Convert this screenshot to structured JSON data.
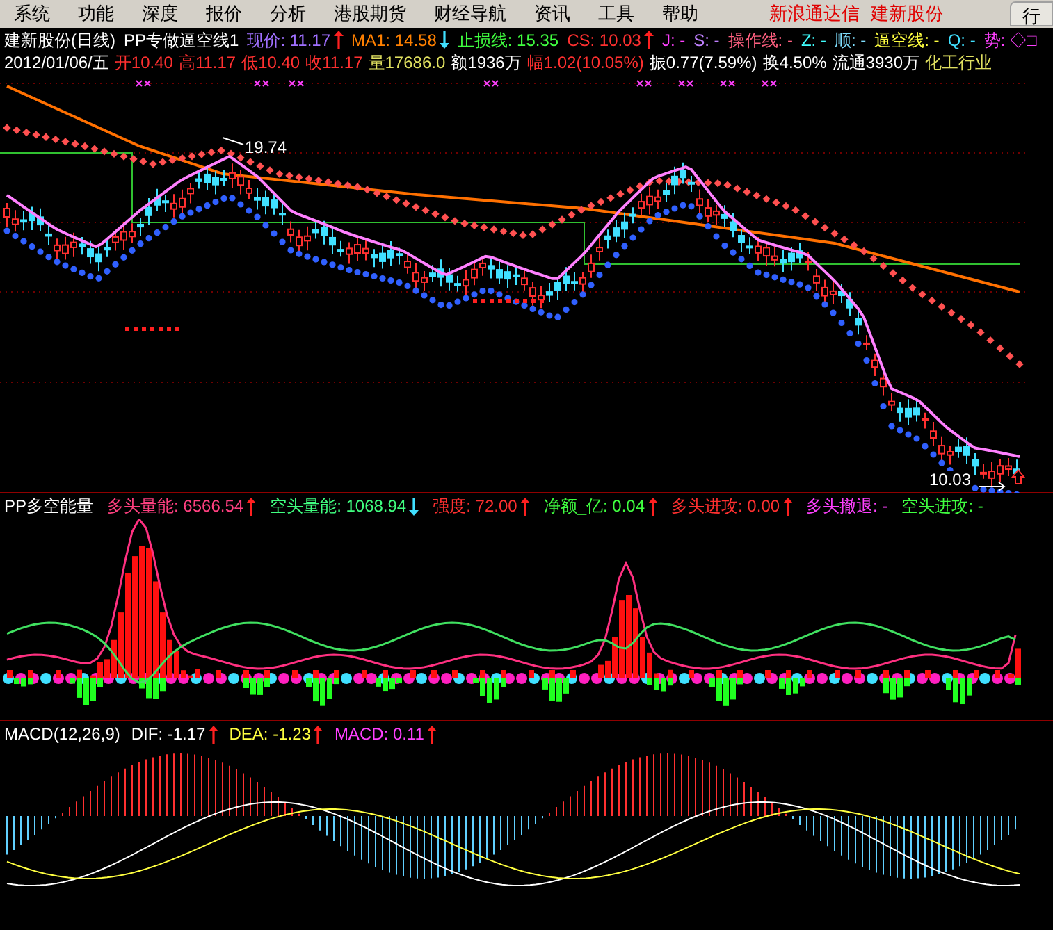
{
  "menu": {
    "items": [
      "系统",
      "功能",
      "深度",
      "报价",
      "分析",
      "港股期货",
      "财经导航",
      "资讯",
      "工具",
      "帮助"
    ],
    "titles": [
      "新浪通达信",
      "建新股份"
    ],
    "tab_button": "行"
  },
  "price_panel": {
    "header": [
      {
        "text": "建新股份(日线)",
        "color": "#ffffff"
      },
      {
        "text": "PP专做逼空线1",
        "color": "#ffffff"
      },
      {
        "text": "现价: 11.17",
        "color": "#a070ff",
        "rising": true
      },
      {
        "text": "MA1: 14.58",
        "color": "#ff8000",
        "rising": false
      },
      {
        "text": "止损线: 15.35",
        "color": "#40ff40"
      },
      {
        "text": "CS: 10.03",
        "color": "#ff3030",
        "rising": true
      },
      {
        "text": "J: -",
        "color": "#ff40ff"
      },
      {
        "text": "S: -",
        "color": "#c080ff"
      },
      {
        "text": "操作线: -",
        "color": "#ff6080"
      },
      {
        "text": "Z: -",
        "color": "#40ffff"
      },
      {
        "text": "顺: -",
        "color": "#80e0ff"
      },
      {
        "text": "逼空线: -",
        "color": "#ffff40"
      },
      {
        "text": "Q: -",
        "color": "#40e0ff"
      },
      {
        "text": "势: ◇□",
        "color": "#ff40ff"
      }
    ],
    "quote": [
      {
        "text": "2012/01/06/五",
        "color": "#ffffff"
      },
      {
        "text": "开10.40",
        "color": "#ff3030"
      },
      {
        "text": "高11.17",
        "color": "#ff3030"
      },
      {
        "text": "低10.40",
        "color": "#ff3030"
      },
      {
        "text": "收11.17",
        "color": "#ff3030"
      },
      {
        "text": "量17686.0",
        "color": "#e0e060"
      },
      {
        "text": "额1936万",
        "color": "#ffffff"
      },
      {
        "text": "幅1.02(10.05%)",
        "color": "#ff3030"
      },
      {
        "text": "振0.77(7.59%)",
        "color": "#ffffff"
      },
      {
        "text": "换4.50%",
        "color": "#ffffff"
      },
      {
        "text": "流通3930万",
        "color": "#ffffff"
      },
      {
        "text": "化工行业",
        "color": "#e0e060"
      }
    ],
    "high_label": "19.74",
    "low_label": "10.03"
  },
  "energy_panel": {
    "header": [
      {
        "text": "PP多空能量",
        "color": "#ffffff"
      },
      {
        "text": "多头量能: 6566.54",
        "color": "#ff4080",
        "rising": true
      },
      {
        "text": "空头量能: 1068.94",
        "color": "#40ff80",
        "rising": false
      },
      {
        "text": "强度: 72.00",
        "color": "#ff3030",
        "rising": true
      },
      {
        "text": "净额_亿: 0.04",
        "color": "#40ff40",
        "rising": true
      },
      {
        "text": "多头进攻: 0.00",
        "color": "#ff3030",
        "rising": true
      },
      {
        "text": "多头撤退: -",
        "color": "#ff40ff"
      },
      {
        "text": "空头进攻: -",
        "color": "#40ff40"
      }
    ]
  },
  "macd_panel": {
    "header": [
      {
        "text": "MACD(12,26,9)",
        "color": "#ffffff"
      },
      {
        "text": "DIF: -1.17",
        "color": "#ffffff",
        "rising": true
      },
      {
        "text": "DEA: -1.23",
        "color": "#ffff40",
        "rising": true
      },
      {
        "text": "MACD: 0.11",
        "color": "#ff40ff",
        "rising": true
      }
    ]
  }
}
